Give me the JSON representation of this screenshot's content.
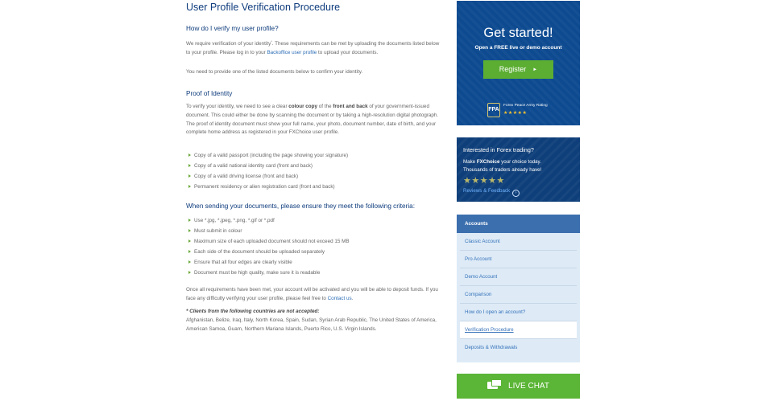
{
  "main": {
    "title": "User Profile Verification Procedure",
    "q1": "How do I verify my user profile?",
    "p1_a": "We require verification of your identity",
    "p1_sup": "*",
    "p1_b": ". These requirements can be met by uploading the documents listed below to your profile. Please log in to your ",
    "p1_link": "Backoffice user profile",
    "p1_c": " to upload your documents.",
    "p2": "You need to provide one of the listed documents below to confirm your identity.",
    "proof_heading": "Proof of Identity",
    "p3_a": "To verify your identity, we need to see a clear ",
    "p3_b1": "colour copy",
    "p3_c": " of the ",
    "p3_b2": "front and back",
    "p3_d": " of your government-issued document. This could either be done by scanning the document or by taking a high-resolution digital photograph. The proof of identity document must show your full name, your photo, document number, date of birth, and your complete home address as registered in your FXChoice user profile.",
    "docs": [
      "Copy of a valid passport (including the page showing your signature)",
      "Copy of a valid national identity card (front and back)",
      "Copy of a valid driving license (front and back)",
      "Permanent residency or alien registration card (front and back)"
    ],
    "criteria_heading": "When sending your documents, please ensure they meet the following criteria:",
    "criteria": [
      "Use *.jpg, *.jpeg, *.png, *.gif or *.pdf",
      "Must submit in colour",
      "Maximum size of each uploaded document should not exceed 15 MB",
      "Each side of the document should be uploaded separately",
      "Ensure that all four edges are clearly visible",
      "Document must be high quality, make sure it is readable"
    ],
    "p4_a": "Once all requirements have been met, your account will be activated and you will be able to deposit funds. If you face any difficulty verifying your user profile, please feel free to ",
    "p4_link": "Contact us",
    "p4_b": ".",
    "countries_heading": "* Clients from the following countries are not accepted:",
    "countries": "Afghanistan, Belize, Iraq, Italy, North Korea, Spain, Sudan, Syrian Arab Republic, The United States of America, American Samoa, Guam, Northern Mariana Islands, Puerto Rico, U.S. Virgin Islands."
  },
  "promo": {
    "title": "Get started!",
    "subtitle": "Open a FREE live or demo account",
    "register_label": "Register",
    "register_arrow": "►",
    "badge_logo": "FPA",
    "badge_text": "Forex Peace Army Rating",
    "badge_stars": "★★★★★"
  },
  "reviews": {
    "question": "Interested in Forex trading?",
    "line1_a": "Make ",
    "line1_b": "FXChoice",
    "line1_c": " your choice today.",
    "line2": "Thousands of traders already have!",
    "stars": "★★★★★",
    "link": "Reviews & Feedback",
    "link_icon": "›"
  },
  "menu": {
    "heading": "Accounts",
    "items": [
      "Classic Account",
      "Pro Account",
      "Demo Account",
      "Comparison",
      "How do I open an account?",
      "Verification Procedure",
      "Deposits & Withdrawals"
    ],
    "active_index": 5
  },
  "livechat": {
    "label": "LIVE CHAT"
  },
  "colors": {
    "brand_blue": "#0d3b7c",
    "green": "#5cae33",
    "link": "#2d6db6"
  }
}
